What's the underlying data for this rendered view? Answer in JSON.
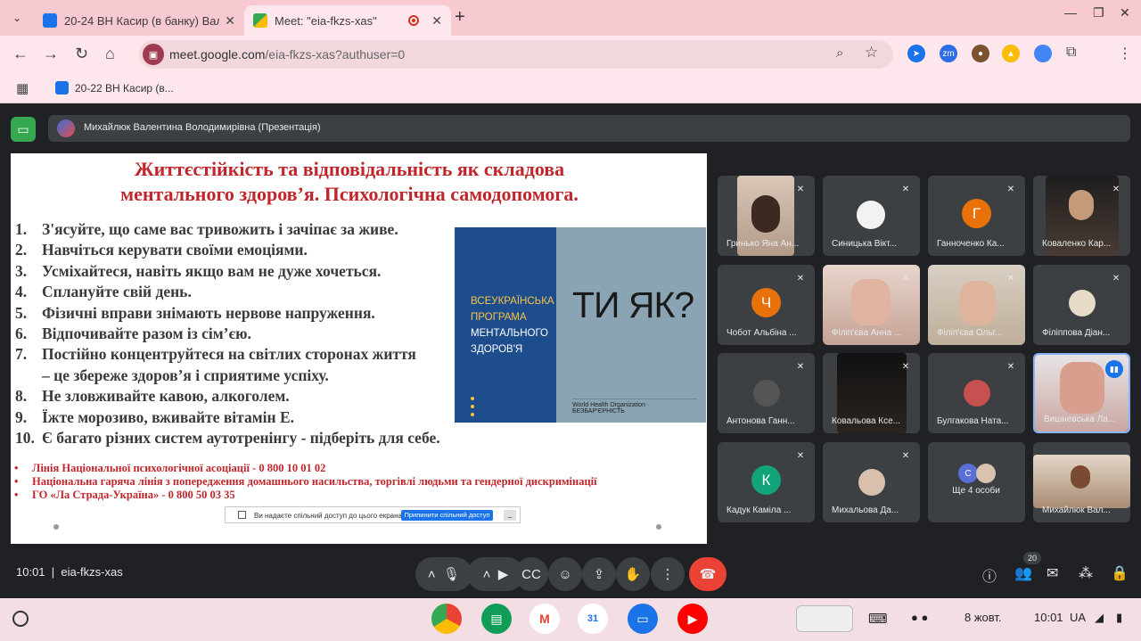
{
  "browser": {
    "tabs": [
      {
        "title": "20-24 ВН Касир (в банку) Вал..."
      },
      {
        "title": "Meet: \"eia-fkzs-xas\""
      }
    ],
    "url_domain": "meet.google.com",
    "url_path": "/eia-fkzs-xas?authuser=0",
    "bookmark": "20-22 ВН Касир (в..."
  },
  "meet": {
    "presenter": "Михайлюк Валентина Володимирівна (Презентація)",
    "meeting_code": "eia-fkzs-xas",
    "time": "10:01",
    "people_count": "20",
    "participants": [
      {
        "name": "Гринько Яна Ан..."
      },
      {
        "name": "Синицька Вікт..."
      },
      {
        "name": "Ганноченко Ка...",
        "initial": "Г",
        "color": "#e8710a"
      },
      {
        "name": "Коваленко Кар..."
      },
      {
        "name": "Чобот Альбіна ...",
        "initial": "Ч",
        "color": "#e8710a"
      },
      {
        "name": "Філіп'єва Анна ..."
      },
      {
        "name": "Філіп'єва Ольг..."
      },
      {
        "name": "Філіппова Діан..."
      },
      {
        "name": "Антонова Ганн..."
      },
      {
        "name": "Ковальова Ксе..."
      },
      {
        "name": "Булгакова Ната..."
      },
      {
        "name": "Вишневська Ла..."
      },
      {
        "name": "Кадук Каміла ...",
        "initial": "К",
        "color": "#12a37a"
      },
      {
        "name": "Михальова Да..."
      },
      {
        "name": "Ще 4 особи",
        "initial": "С"
      },
      {
        "name": "Михайлюк Вал..."
      }
    ]
  },
  "slide": {
    "title_line1": "Життєстійкість та відповідальність як складова",
    "title_line2": "ментального здоров’я. Психологічна самодопомога.",
    "items": [
      {
        "n": "1.",
        "text": "З'ясуйте, що саме вас тривожить і зачіпає за живе."
      },
      {
        "n": "2.",
        "text": "Навчіться керувати своїми емоціями."
      },
      {
        "n": "3.",
        "text": "Усміхайтеся, навіть якщо вам не дуже хочеться."
      },
      {
        "n": "4.",
        "text": "Сплануйте свій день."
      },
      {
        "n": "5.",
        "text": "Фізичні вправи знімають нервове напруження."
      },
      {
        "n": "6.",
        "text": "Відпочивайте разом із сім’єю."
      },
      {
        "n": "7.",
        "text": "Постійно концентруйтеся на світлих сторонах життя"
      },
      {
        "n": "",
        "text": "– це збереже здоров’я і сприятиме успіху."
      },
      {
        "n": "8.",
        "text": "Не зловживайте кавою, алкоголем."
      },
      {
        "n": "9.",
        "text": "Їжте морозиво, вживайте вітамін Е."
      },
      {
        "n": "10.",
        "text": "Є багато різних систем аутотренінгу - підберіть для себе."
      }
    ],
    "hotlines": [
      "Лінія Національної психологічної асоціації - 0 800 10 01 02",
      "Національна гаряча лінія з попередження домашнього насильства, торгівлі людьми та гендерної дискримінації",
      "ГО «Ла Страда-Україна» - 0 800 50 03 35"
    ],
    "logo": {
      "line1": "ВСЕУКРАЇНСЬКА",
      "line2": "ПРОГРАМА",
      "line3": "МЕНТАЛЬНОГО",
      "line4": "ЗДОРОВ'Я",
      "big": "ТИ ЯК?",
      "footer": "World Health Organization · БЕЗБАР'ЄРНІСТЬ"
    },
    "share_notice": "Ви надаєте спільний доступ до цього екрана.",
    "share_button": "Припинити спільний доступ"
  },
  "shelf": {
    "date": "8 жовт.",
    "time": "10:01",
    "lang": "UA"
  }
}
